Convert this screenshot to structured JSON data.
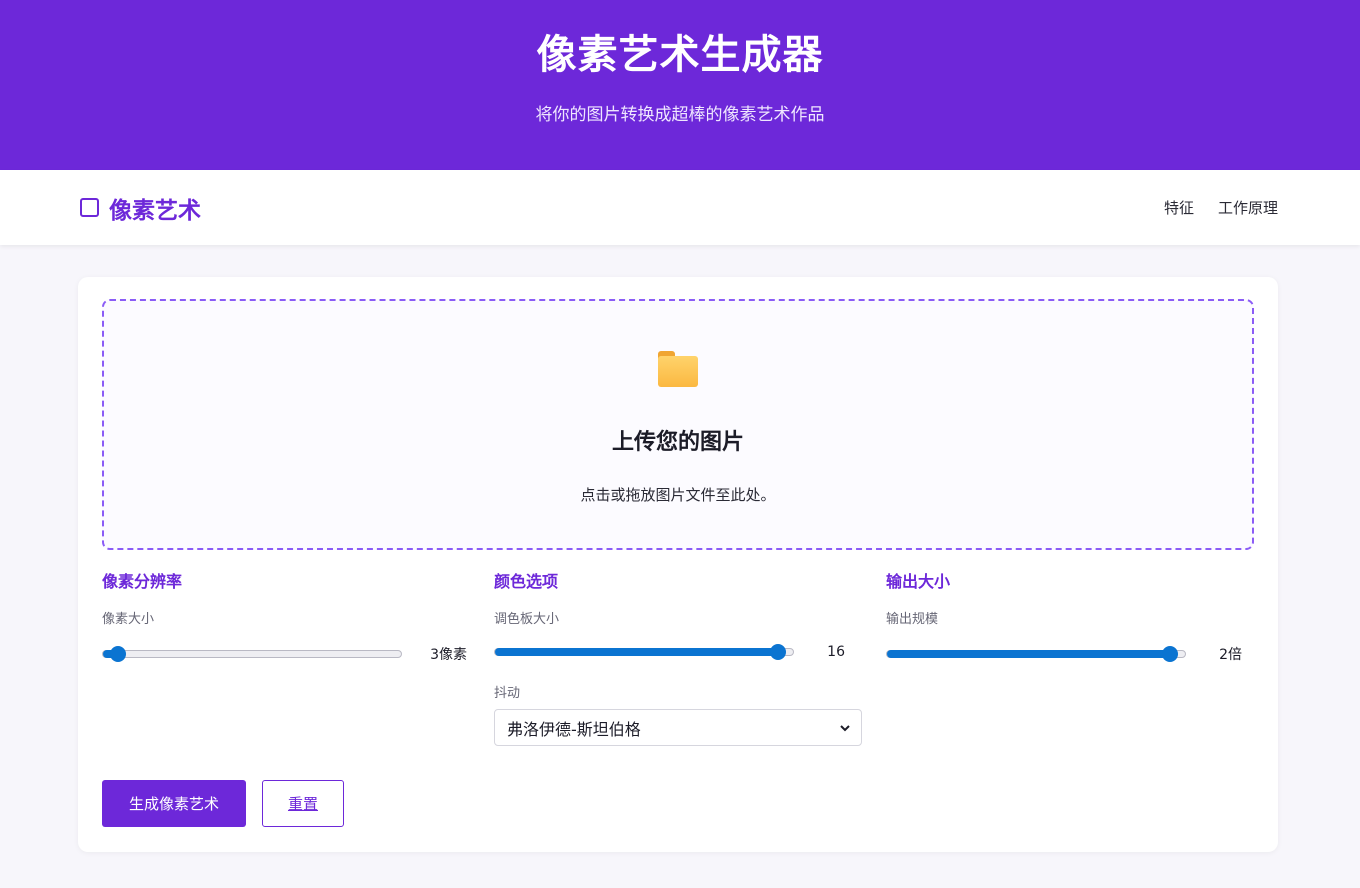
{
  "hero": {
    "title": "像素艺术生成器",
    "subtitle": "将你的图片转换成超棒的像素艺术作品"
  },
  "navbar": {
    "brand_icon": "square-outline-icon",
    "brand_label": "像素艺术",
    "links": [
      {
        "label": "特征"
      },
      {
        "label": "工作原理"
      }
    ]
  },
  "upload": {
    "icon": "folder-icon",
    "title": "上传您的图片",
    "hint": "点击或拖放图片文件至此处。"
  },
  "controls": {
    "resolution": {
      "title": "像素分辨率",
      "pixel_size_label": "像素大小",
      "pixel_size_value": "3像素",
      "pixel_size_fraction": 0.05
    },
    "color": {
      "title": "颜色选项",
      "palette_label": "调色板大小",
      "palette_value": "16",
      "palette_fraction": 0.95,
      "dither_label": "抖动",
      "dither_value": "弗洛伊德-斯坦伯格"
    },
    "output": {
      "title": "输出大小",
      "scale_label": "输出规模",
      "scale_value": "2倍",
      "scale_fraction": 0.95
    }
  },
  "actions": {
    "generate_label": "生成像素艺术",
    "reset_label": "重置"
  },
  "colors": {
    "brand": "#6d28d9",
    "slider": "#0b74d1"
  }
}
